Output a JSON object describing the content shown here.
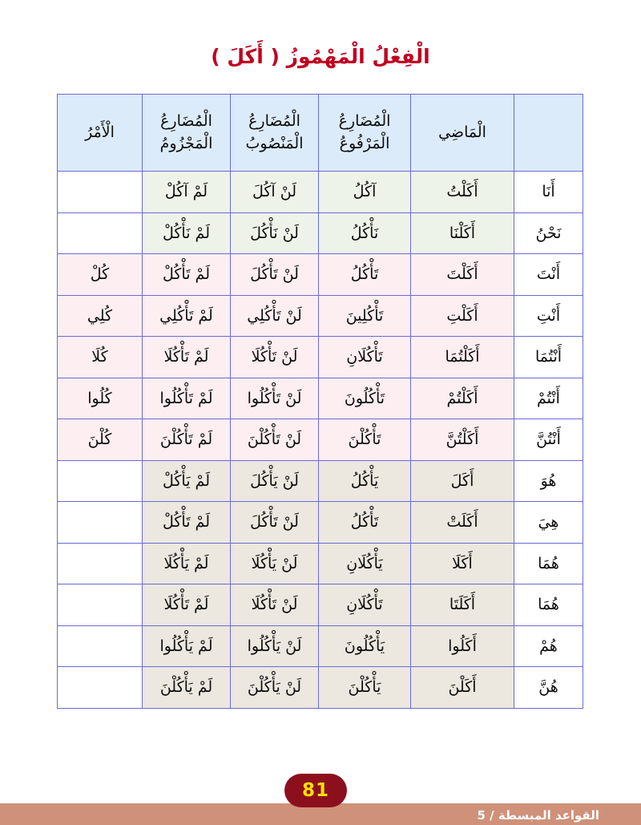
{
  "page": {
    "title": "الْفِعْلُ الْمَهْمُوزُ ( أَكَلَ )",
    "title_color": "#c00020",
    "background": "#ffffff"
  },
  "table": {
    "header_background": "#dcebfa",
    "border_color": "#6a6ad6",
    "headers": [
      {
        "key": "pronoun",
        "label": ""
      },
      {
        "key": "madi",
        "label": "الْمَاضِي"
      },
      {
        "key": "marfu",
        "label_line1": "الْمُضَارِعُ",
        "label_line2": "الْمَرْفُوعُ"
      },
      {
        "key": "mansub",
        "label_line1": "الْمُضَارِعُ",
        "label_line2": "الْمَنْصُوبُ"
      },
      {
        "key": "majzum",
        "label_line1": "الْمُضَارِعُ",
        "label_line2": "الْمَجْزُومُ"
      },
      {
        "key": "amr",
        "label": "الْأَمْرُ"
      }
    ],
    "rows": [
      {
        "tint": "green",
        "pronoun": "أَنَا",
        "madi": "أَكَلْتُ",
        "marfu": "آكُلُ",
        "mansub": "لَنْ آكُلَ",
        "majzum": "لَمْ آكُلْ",
        "amr": ""
      },
      {
        "tint": "green",
        "pronoun": "نَحْنُ",
        "madi": "أَكَلْنَا",
        "marfu": "نَأْكُلُ",
        "mansub": "لَنْ نَأْكُلَ",
        "majzum": "لَمْ نَأْكُلْ",
        "amr": ""
      },
      {
        "tint": "pink",
        "pronoun": "أَنْتَ",
        "madi": "أَكَلْتَ",
        "marfu": "تَأْكُلُ",
        "mansub": "لَنْ تَأْكُلَ",
        "majzum": "لَمْ تَأْكُلْ",
        "amr": "كُلْ"
      },
      {
        "tint": "pink",
        "pronoun": "أَنْتِ",
        "madi": "أَكَلْتِ",
        "marfu": "تَأْكُلِينَ",
        "mansub": "لَنْ تَأْكُلِي",
        "majzum": "لَمْ تَأْكُلِي",
        "amr": "كُلِي"
      },
      {
        "tint": "pink",
        "pronoun": "أَنْتُمَا",
        "madi": "أَكَلْتُمَا",
        "marfu": "تَأْكُلَانِ",
        "mansub": "لَنْ تَأْكُلَا",
        "majzum": "لَمْ تَأْكُلَا",
        "amr": "كُلَا"
      },
      {
        "tint": "pink",
        "pronoun": "أَنْتُمْ",
        "madi": "أَكَلْتُمْ",
        "marfu": "تَأْكُلُونَ",
        "mansub": "لَنْ تَأْكُلُوا",
        "majzum": "لَمْ تَأْكُلُوا",
        "amr": "كُلُوا"
      },
      {
        "tint": "pink",
        "pronoun": "أَنْتُنَّ",
        "madi": "أَكَلْتُنَّ",
        "marfu": "تَأْكُلْنَ",
        "mansub": "لَنْ تَأْكُلْنَ",
        "majzum": "لَمْ تَأْكُلْنَ",
        "amr": "كُلْنَ"
      },
      {
        "tint": "beige",
        "pronoun": "هُوَ",
        "madi": "أَكَلَ",
        "marfu": "يَأْكُلُ",
        "mansub": "لَنْ يَأْكُلَ",
        "majzum": "لَمْ يَأْكُلْ",
        "amr": ""
      },
      {
        "tint": "beige",
        "pronoun": "هِيَ",
        "madi": "أَكَلَتْ",
        "marfu": "تَأْكُلُ",
        "mansub": "لَنْ تَأْكُلَ",
        "majzum": "لَمْ تَأْكُلْ",
        "amr": ""
      },
      {
        "tint": "beige",
        "pronoun": "هُمَا",
        "madi": "أَكَلَا",
        "marfu": "يَأْكُلَانِ",
        "mansub": "لَنْ يَأْكُلَا",
        "majzum": "لَمْ يَأْكُلَا",
        "amr": ""
      },
      {
        "tint": "beige",
        "pronoun": "هُمَا",
        "madi": "أَكَلَتَا",
        "marfu": "تَأْكُلَانِ",
        "mansub": "لَنْ تَأْكُلَا",
        "majzum": "لَمْ تَأْكُلَا",
        "amr": ""
      },
      {
        "tint": "beige",
        "pronoun": "هُمْ",
        "madi": "أَكَلُوا",
        "marfu": "يَأْكُلُونَ",
        "mansub": "لَنْ يَأْكُلُوا",
        "majzum": "لَمْ يَأْكُلُوا",
        "amr": ""
      },
      {
        "tint": "beige",
        "pronoun": "هُنَّ",
        "madi": "أَكَلْنَ",
        "marfu": "يَأْكُلْنَ",
        "mansub": "لَنْ يَأْكُلْنَ",
        "majzum": "لَمْ يَأْكُلْنَ",
        "amr": ""
      }
    ]
  },
  "footer": {
    "page_number": "81",
    "book_line": "القواعد المبسطة / 5",
    "bar_color": "#cf9179",
    "badge_color": "#8c0f1e",
    "badge_text_color": "#ffe000"
  }
}
